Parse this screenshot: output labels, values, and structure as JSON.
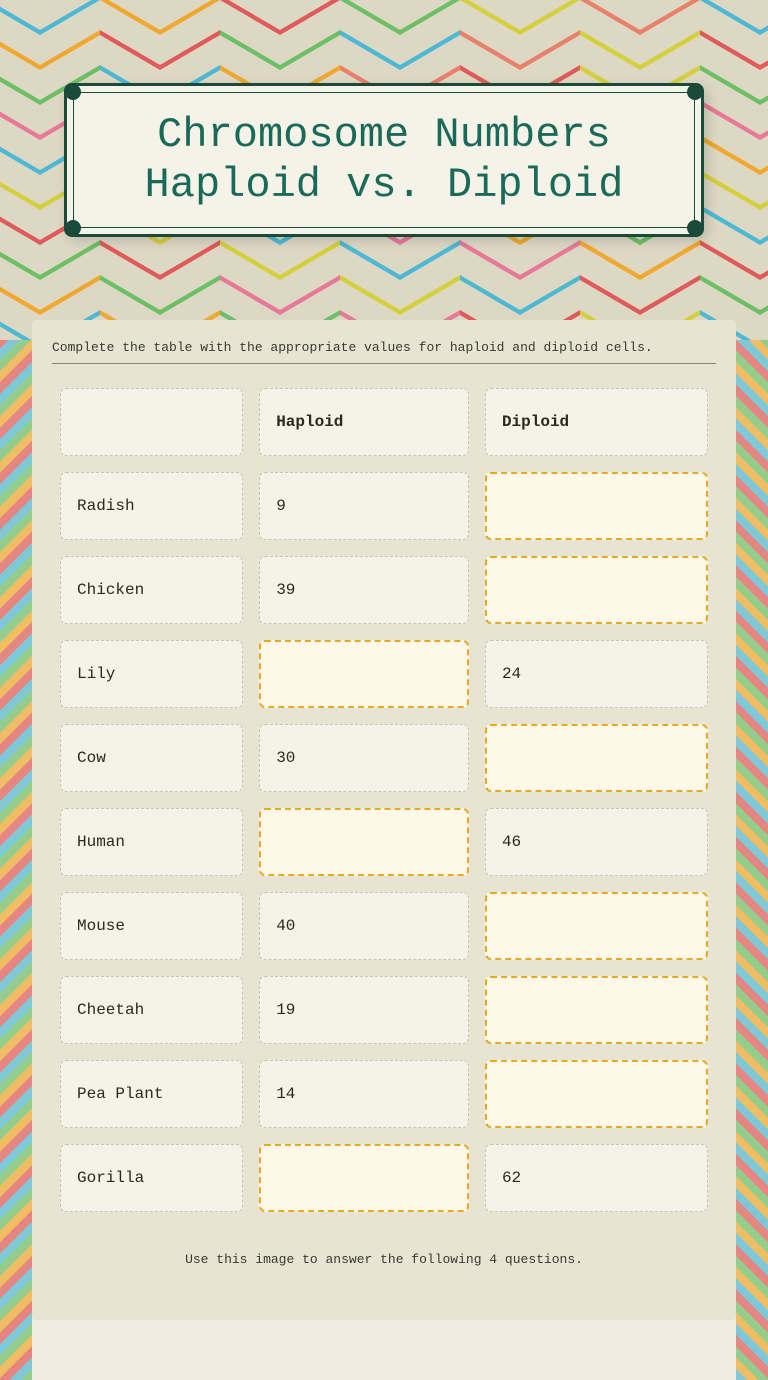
{
  "title": {
    "line1": "Chromosome Numbers",
    "line2": "Haploid vs. Diploid"
  },
  "instructions": "Complete the table with the appropriate values for haploid and diploid cells.",
  "table": {
    "headers": [
      "",
      "Haploid",
      "Diploid"
    ],
    "rows": [
      {
        "organism": "Radish",
        "haploid": "9",
        "diploid": "",
        "haploid_filled": true,
        "diploid_filled": false
      },
      {
        "organism": "Chicken",
        "haploid": "39",
        "diploid": "",
        "haploid_filled": true,
        "diploid_filled": false
      },
      {
        "organism": "Lily",
        "haploid": "",
        "diploid": "24",
        "haploid_filled": false,
        "diploid_filled": true
      },
      {
        "organism": "Cow",
        "haploid": "30",
        "diploid": "",
        "haploid_filled": true,
        "diploid_filled": false
      },
      {
        "organism": "Human",
        "haploid": "",
        "diploid": "46",
        "haploid_filled": false,
        "diploid_filled": true
      },
      {
        "organism": "Mouse",
        "haploid": "40",
        "diploid": "",
        "haploid_filled": true,
        "diploid_filled": false
      },
      {
        "organism": "Cheetah",
        "haploid": "19",
        "diploid": "",
        "haploid_filled": true,
        "diploid_filled": false
      },
      {
        "organism": "Pea Plant",
        "haploid": "14",
        "diploid": "",
        "haploid_filled": true,
        "diploid_filled": false
      },
      {
        "organism": "Gorilla",
        "haploid": "",
        "diploid": "62",
        "haploid_filled": false,
        "diploid_filled": true
      }
    ]
  },
  "footer": "Use this image to answer the following 4 questions."
}
